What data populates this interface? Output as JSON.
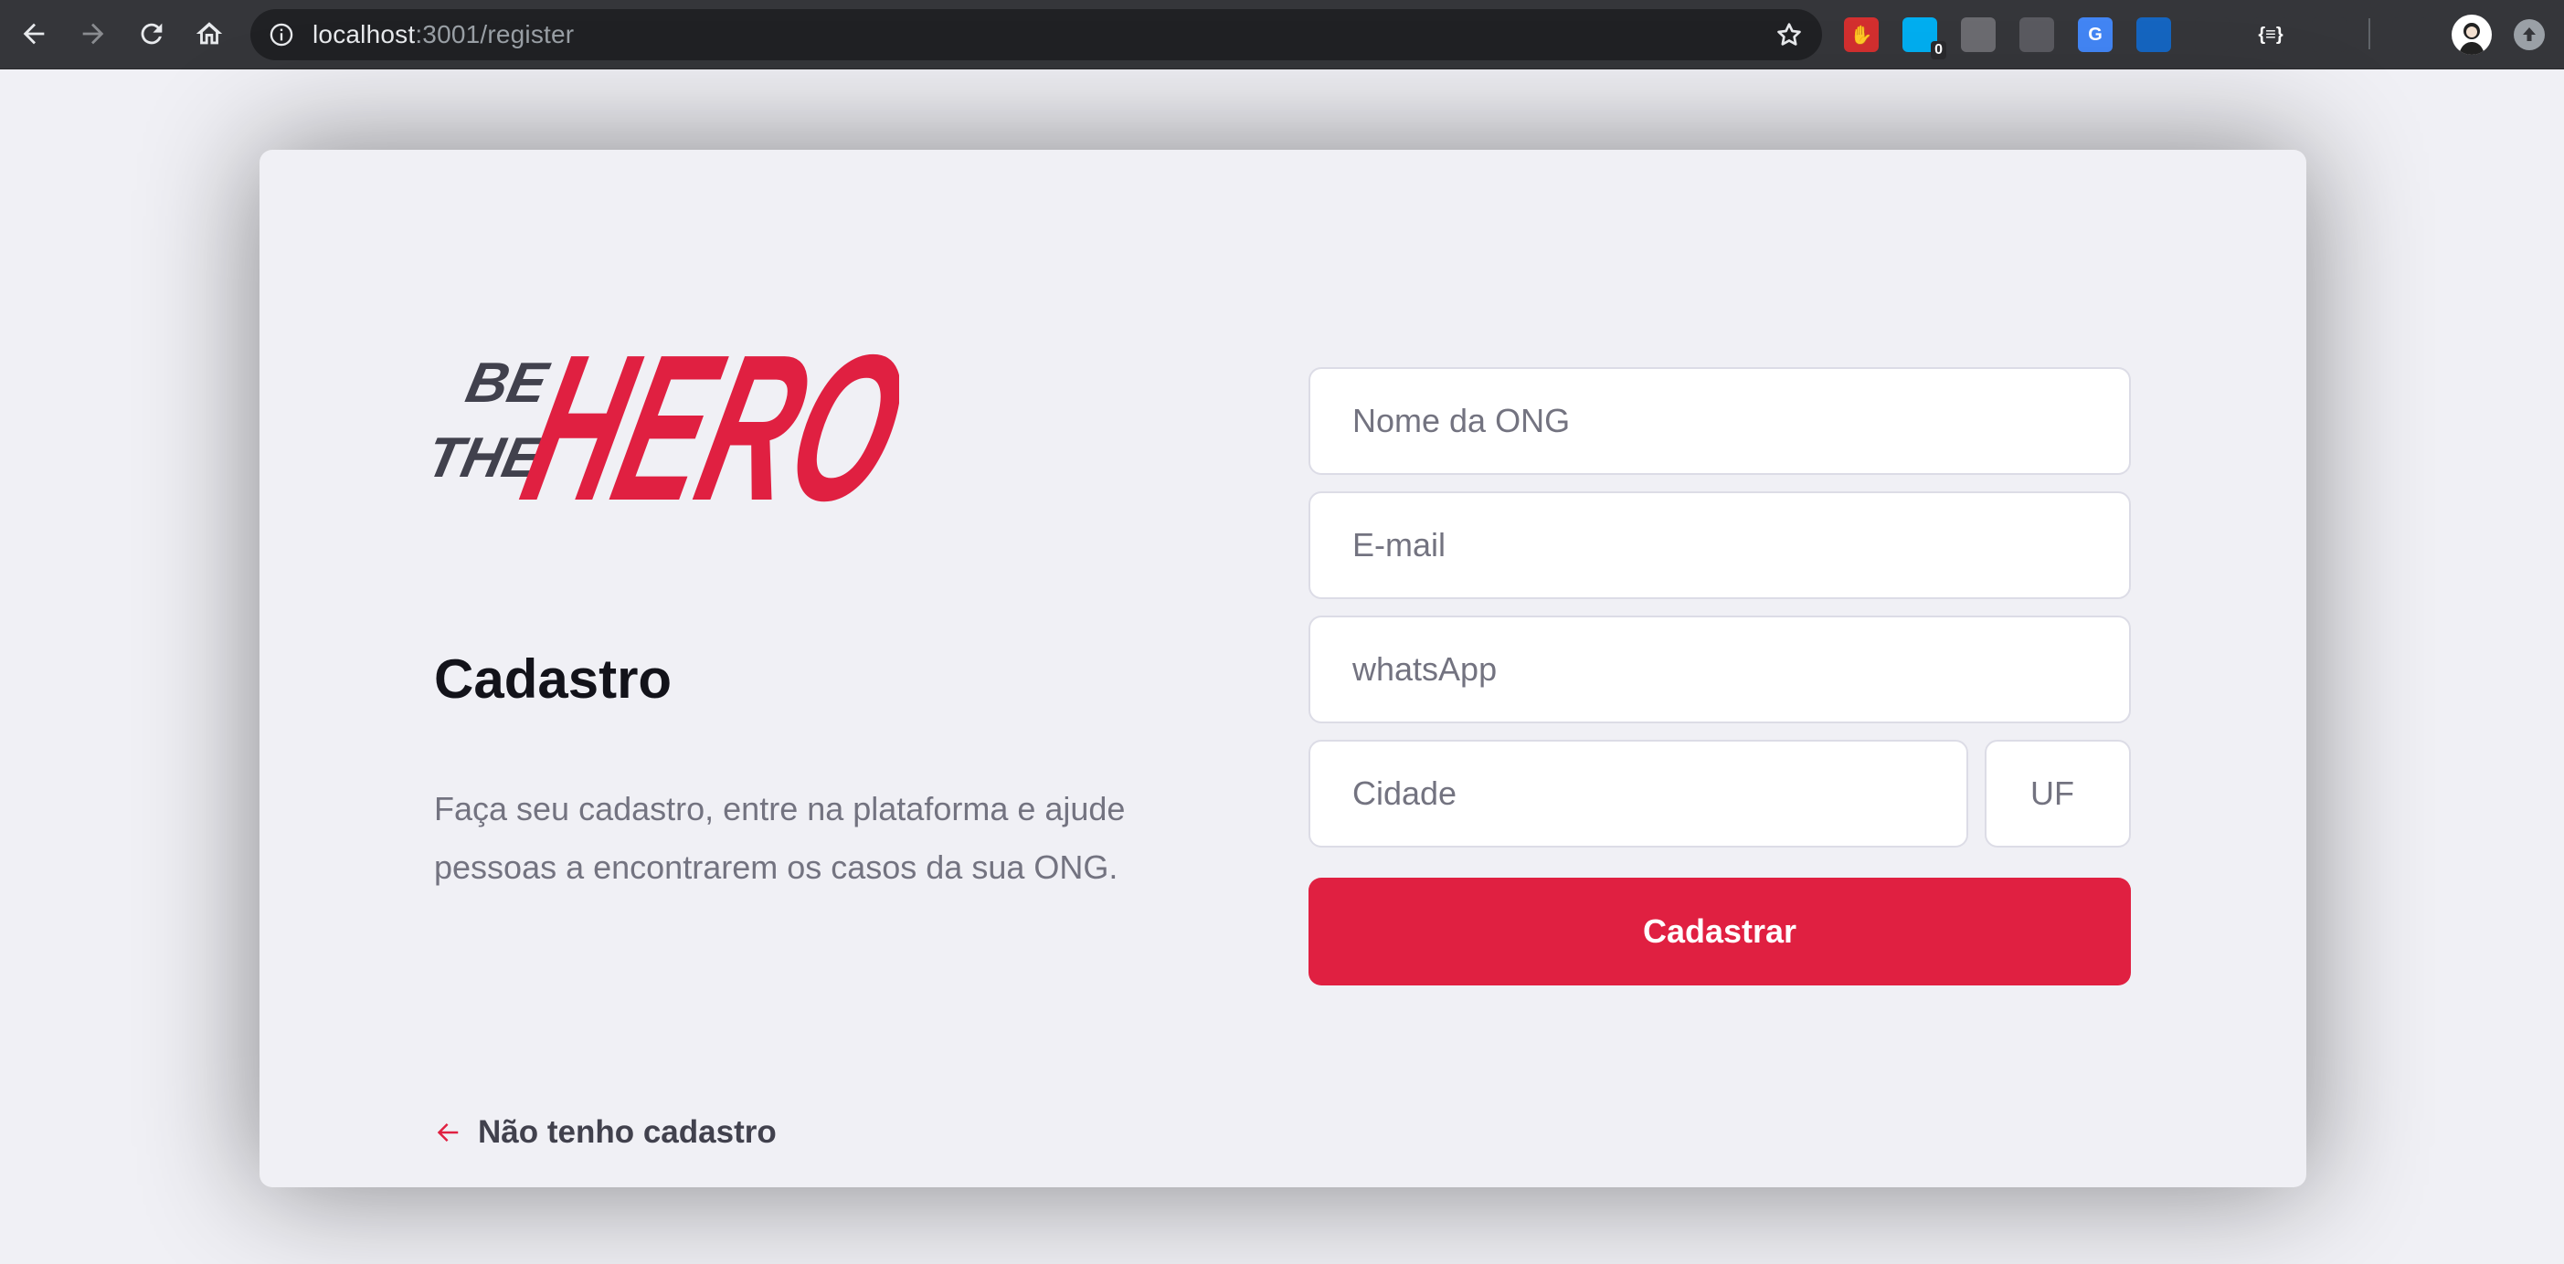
{
  "browser": {
    "url_host": "localhost",
    "url_path": ":3001/register",
    "extensions": [
      {
        "name": "ublock-icon",
        "color": "#d32f2f",
        "label": "✋"
      },
      {
        "name": "ghostery-icon",
        "color": "#00aef0",
        "label": "",
        "badge": "0"
      },
      {
        "name": "lightbulb-icon",
        "color": "#6b6b70",
        "label": ""
      },
      {
        "name": "mailbox-icon",
        "color": "#5a5a60",
        "label": ""
      },
      {
        "name": "google-translate-icon",
        "color": "#4285f4",
        "label": "G"
      },
      {
        "name": "apps-grid-icon",
        "color": "#1565c0",
        "label": ""
      },
      {
        "name": "fox-icon",
        "color": "#35363a",
        "label": ""
      },
      {
        "name": "json-icon",
        "color": "#35363a",
        "label": "{≡}"
      },
      {
        "name": "triangle-icon",
        "color": "#35363a",
        "label": ""
      },
      {
        "name": "media-queue-icon",
        "color": "#35363a",
        "label": ""
      }
    ]
  },
  "logo": {
    "line1": "BE",
    "line2": "THE",
    "hero": "HERO",
    "colors": {
      "dark": "#41414d",
      "red": "#e02041"
    }
  },
  "page": {
    "title": "Cadastro",
    "description": "Faça seu cadastro, entre na plataforma e ajude pessoas a encontrarem os casos da sua ONG.",
    "back_link": "Não tenho cadastro"
  },
  "form": {
    "name_placeholder": "Nome da ONG",
    "email_placeholder": "E-mail",
    "whatsapp_placeholder": "whatsApp",
    "city_placeholder": "Cidade",
    "uf_placeholder": "UF",
    "submit_label": "Cadastrar"
  },
  "colors": {
    "accent": "#e02041",
    "background": "#f0f0f5",
    "text_dark": "#13131a",
    "text_muted": "#737380"
  }
}
